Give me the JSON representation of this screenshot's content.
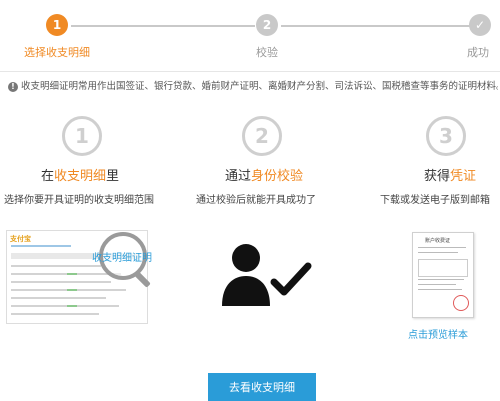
{
  "steps": [
    {
      "number": "1",
      "label": "选择收支明细",
      "state": "active"
    },
    {
      "number": "2",
      "label": "校验",
      "state": "pending"
    },
    {
      "number": "✓",
      "label": "成功",
      "state": "pending"
    }
  ],
  "notice": "收支明细证明常用作出国签证、银行贷款、婚前财产证明、离婚财产分割、司法诉讼、国税稽查等事务的证明材料。",
  "columns": [
    {
      "number": "1",
      "title_prefix": "在",
      "title_highlight": "收支明细",
      "title_suffix": "里",
      "desc": "选择你要开具证明的收支明细范围"
    },
    {
      "number": "2",
      "title_prefix": "通过",
      "title_highlight": "身份校验",
      "title_suffix": "",
      "desc": "通过校验后就能开具成功了"
    },
    {
      "number": "3",
      "title_prefix": "获得",
      "title_highlight": "凭证",
      "title_suffix": "",
      "desc": "下载或发送电子版到邮箱"
    }
  ],
  "thumbnail": {
    "logo": "支付宝",
    "magnifier_text": "收支明细证明"
  },
  "document": {
    "title": "账户收费证"
  },
  "preview_link": "点击预览样本",
  "cta_label": "去看收支明细",
  "colors": {
    "accent": "#f08a24",
    "primary": "#2a9cd8",
    "inactive": "#cfcfcf"
  }
}
